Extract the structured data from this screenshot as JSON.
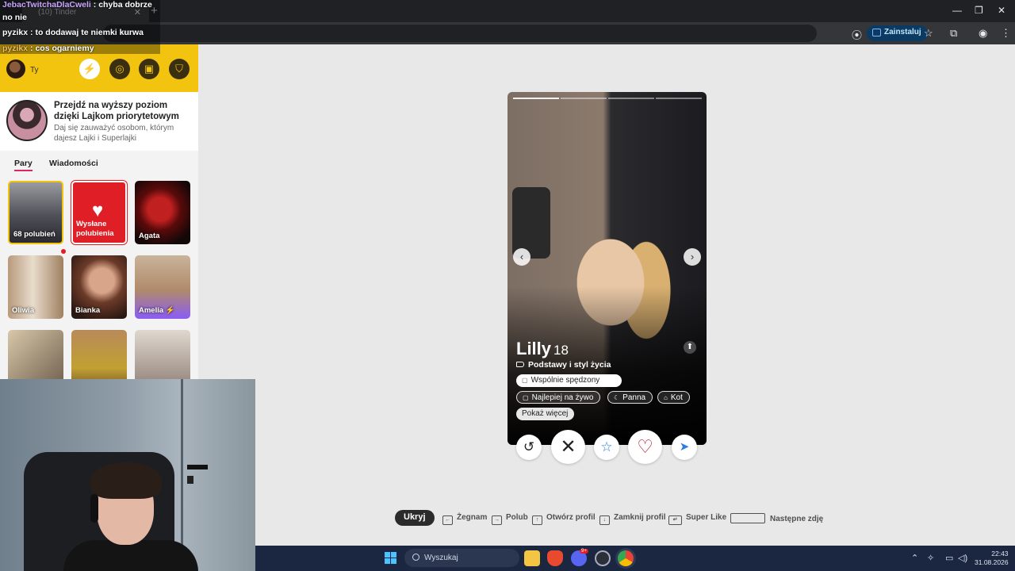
{
  "browser": {
    "tab_title": "(10) Tinder",
    "url_hint": "recs",
    "install_label": "Zainstaluj"
  },
  "chat_overlay": {
    "lines": [
      {
        "user": "JebacTwitchaDlaCweli",
        "text": "chyba dobrze"
      },
      {
        "user": "",
        "text": "no nie"
      },
      {
        "user": "pyzikx",
        "text": "to dodawaj te niemki kurwa"
      },
      {
        "user": "pyzikx",
        "text": "cos ogarniemy"
      }
    ]
  },
  "sidebar": {
    "user_name": "Ty",
    "promo_title": "Przejdź na wyższy poziom dzięki Lajkom priorytetowym",
    "promo_subtitle": "Daj się zauważyć osobom, którym dajesz Lajki i Superlajki",
    "tabs": [
      "Pary",
      "Wiadomości"
    ],
    "cards": [
      {
        "label": "68 polubień"
      },
      {
        "label": "Wysłane polubienia"
      },
      {
        "label": "Agata"
      },
      {
        "label": "Oliwia"
      },
      {
        "label": "Bianka"
      },
      {
        "label": "Amelia ⚡"
      },
      {
        "label": ""
      },
      {
        "label": ""
      },
      {
        "label": ""
      }
    ]
  },
  "profile": {
    "name": "Lilly",
    "age": "18",
    "section": "Podstawy i styl życia",
    "chips": [
      "Wspólnie spędzony",
      "Najlepiej na żywo",
      "Panna",
      "Kot",
      "Pokaż więcej"
    ]
  },
  "hints": {
    "hide": "Ukryj",
    "items": [
      "Żegnam",
      "Polub",
      "Otwórz profil",
      "Zamknij profil",
      "Super Like",
      "Następne zdję"
    ]
  },
  "taskbar": {
    "search_placeholder": "Wyszukaj",
    "time": "22:43",
    "date": "31.08.2026",
    "discord_badge": "9+"
  },
  "colors": {
    "tinder_yellow": "#f2c40f",
    "like_red": "#e01e26",
    "taskbar_bg": "#1b2740"
  }
}
